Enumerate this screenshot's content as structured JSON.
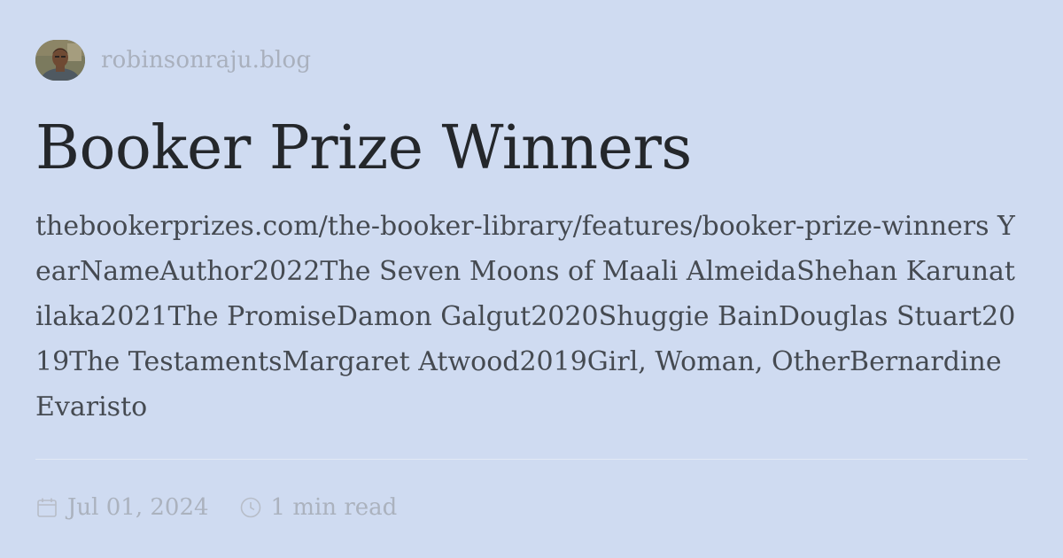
{
  "site": {
    "name": "robinsonraju.blog",
    "avatar_icon": "author-avatar-photo"
  },
  "post": {
    "title": "Booker Prize Winners",
    "excerpt": "thebookerprizes.com/the-booker-library/features/booker-prize-winners YearNameAuthor2022The Seven Moons of Maali AlmeidaShehan Karunatilaka2021The PromiseDamon Galgut2020Shuggie BainDouglas Stuart2019The TestamentsMargaret Atwood2019Girl, Woman, OtherBernardine Evaristo"
  },
  "meta": {
    "date": "Jul 01, 2024",
    "date_icon": "calendar-icon",
    "read_time": "1 min read",
    "read_time_icon": "clock-icon"
  },
  "colors": {
    "background": "#cfdbf1",
    "title": "#24272b",
    "excerpt": "#454a51",
    "muted": "#abb2be"
  }
}
